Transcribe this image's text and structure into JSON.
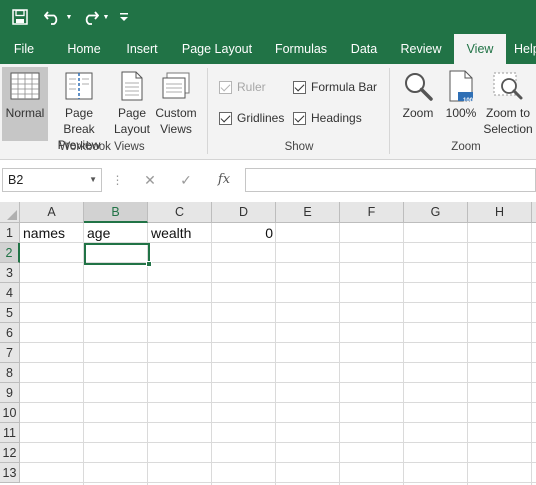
{
  "quick_access": {
    "icons": [
      "save-icon",
      "undo-icon",
      "redo-icon",
      "customize-icon"
    ]
  },
  "tabs": [
    "File",
    "Home",
    "Insert",
    "Page Layout",
    "Formulas",
    "Data",
    "Review",
    "View",
    "Help"
  ],
  "active_tab": "View",
  "ribbon": {
    "workbook_views": {
      "label": "Workbook Views",
      "buttons": [
        {
          "line1": "Normal",
          "line2": ""
        },
        {
          "line1": "Page Break",
          "line2": "Preview"
        },
        {
          "line1": "Page",
          "line2": "Layout"
        },
        {
          "line1": "Custom",
          "line2": "Views"
        }
      ]
    },
    "show": {
      "label": "Show",
      "ruler": "Ruler",
      "formula_bar": "Formula Bar",
      "gridlines": "Gridlines",
      "headings": "Headings"
    },
    "zoom": {
      "label": "Zoom",
      "buttons": [
        {
          "line1": "Zoom",
          "line2": ""
        },
        {
          "line1": "100%",
          "line2": ""
        },
        {
          "line1": "Zoom to",
          "line2": "Selection"
        }
      ],
      "badge": "100"
    }
  },
  "formula_bar": {
    "name_box": "B2",
    "fx_label": "fx",
    "value": ""
  },
  "sheet": {
    "columns": [
      "A",
      "B",
      "C",
      "D",
      "E",
      "F",
      "G",
      "H"
    ],
    "rows": [
      "1",
      "2",
      "3",
      "4",
      "5",
      "6",
      "7",
      "8",
      "9",
      "10",
      "11",
      "12",
      "13"
    ],
    "cells": {
      "A1": "names",
      "B1": "age",
      "C1": "wealth",
      "D1": "0"
    },
    "selected_cell": "B2"
  },
  "colors": {
    "brand": "#217346",
    "ribbon_bg": "#f3f3f3"
  }
}
